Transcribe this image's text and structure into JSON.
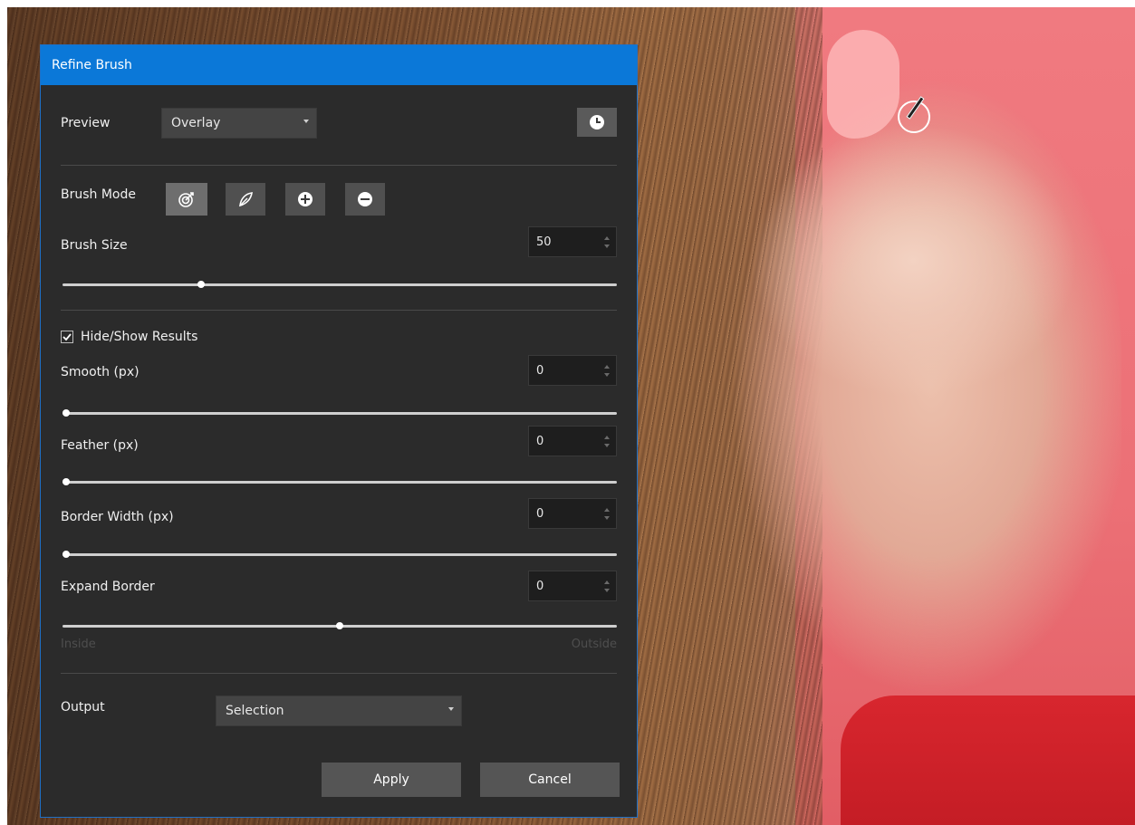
{
  "dialog": {
    "title": "Refine Brush",
    "preview": {
      "label": "Preview",
      "value": "Overlay"
    },
    "brush_mode": {
      "label": "Brush Mode",
      "modes": [
        "target-brush",
        "feather-brush",
        "add-brush",
        "subtract-brush"
      ],
      "active_mode": "target-brush"
    },
    "brush_size": {
      "label": "Brush Size",
      "value": "50",
      "slider_fraction": 0.25
    },
    "hide_show": {
      "label": "Hide/Show Results",
      "checked": true
    },
    "smooth": {
      "label": "Smooth (px)",
      "value": "0",
      "slider_fraction": 0.0
    },
    "feather": {
      "label": "Feather (px)",
      "value": "0",
      "slider_fraction": 0.0
    },
    "border_width": {
      "label": "Border Width (px)",
      "value": "0",
      "slider_fraction": 0.0
    },
    "expand_border": {
      "label": "Expand Border",
      "value": "0",
      "slider_fraction": 0.5,
      "min_label": "Inside",
      "max_label": "Outside"
    },
    "output": {
      "label": "Output",
      "value": "Selection"
    },
    "apply_label": "Apply",
    "cancel_label": "Cancel"
  },
  "colors": {
    "titlebar": "#0b78d8",
    "panel": "#2b2b2b",
    "background_pink": "#ec7076"
  }
}
